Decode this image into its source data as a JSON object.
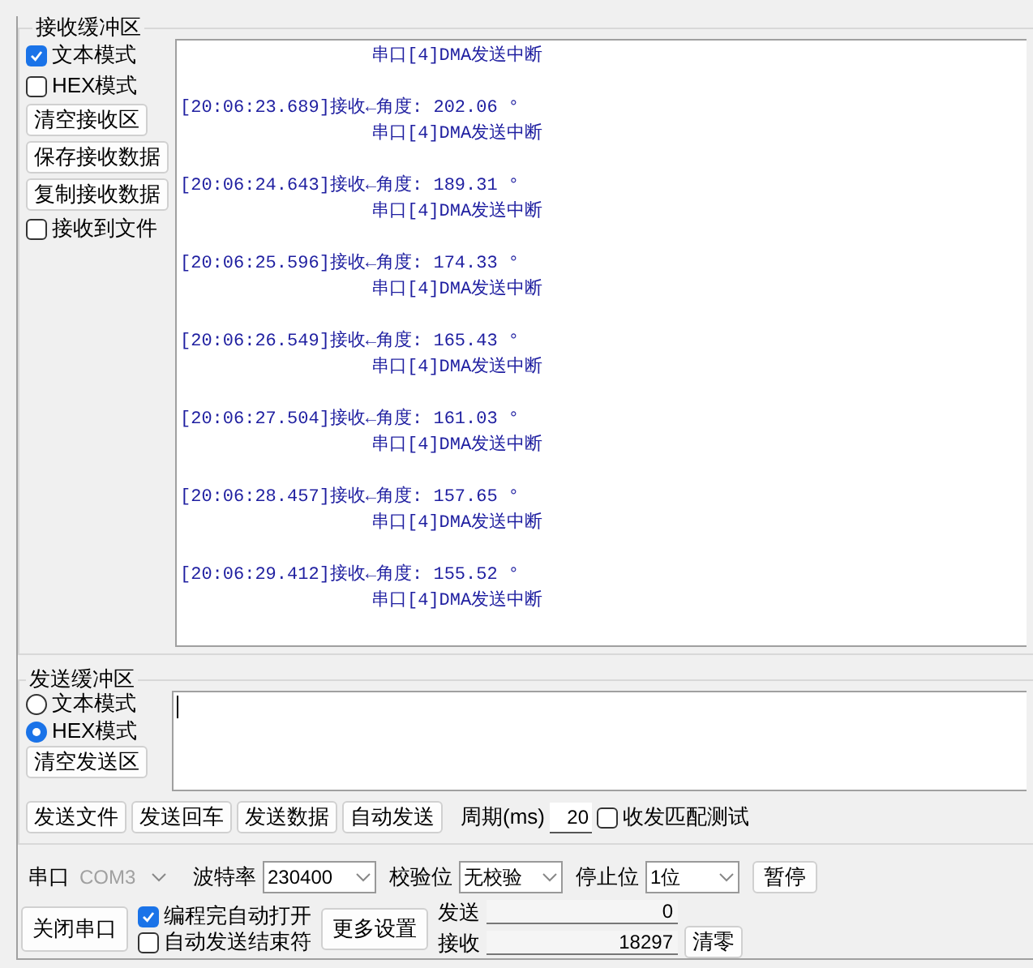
{
  "receive": {
    "title": "接收缓冲区",
    "controls": [
      {
        "kind": "checkbox",
        "label": "文本模式",
        "checked": true
      },
      {
        "kind": "checkbox",
        "label": "HEX模式",
        "checked": false
      },
      {
        "kind": "button",
        "label": "清空接收区"
      },
      {
        "kind": "button",
        "label": "保存接收数据"
      },
      {
        "kind": "button",
        "label": "复制接收数据"
      },
      {
        "kind": "checkbox",
        "label": "接收到文件",
        "checked": false
      }
    ],
    "log": [
      {
        "kind": "status",
        "text": "串口[4]DMA发送中断"
      },
      {
        "kind": "data",
        "text": "[20:06:23.689]接收←角度: 202.06 °"
      },
      {
        "kind": "status",
        "text": "串口[4]DMA发送中断"
      },
      {
        "kind": "data",
        "text": "[20:06:24.643]接收←角度: 189.31 °"
      },
      {
        "kind": "status",
        "text": "串口[4]DMA发送中断"
      },
      {
        "kind": "data",
        "text": "[20:06:25.596]接收←角度: 174.33 °"
      },
      {
        "kind": "status",
        "text": "串口[4]DMA发送中断"
      },
      {
        "kind": "data",
        "text": "[20:06:26.549]接收←角度: 165.43 °"
      },
      {
        "kind": "status",
        "text": "串口[4]DMA发送中断"
      },
      {
        "kind": "data",
        "text": "[20:06:27.504]接收←角度: 161.03 °"
      },
      {
        "kind": "status",
        "text": "串口[4]DMA发送中断"
      },
      {
        "kind": "data",
        "text": "[20:06:28.457]接收←角度: 157.65 °"
      },
      {
        "kind": "status",
        "text": "串口[4]DMA发送中断"
      },
      {
        "kind": "data",
        "text": "[20:06:29.412]接收←角度: 155.52 °"
      },
      {
        "kind": "status",
        "text": "串口[4]DMA发送中断"
      }
    ]
  },
  "send": {
    "title": "发送缓冲区",
    "modes": [
      {
        "label": "文本模式",
        "selected": false
      },
      {
        "label": "HEX模式",
        "selected": true
      }
    ],
    "clear_button": "清空发送区",
    "actions": [
      "发送文件",
      "发送回车",
      "发送数据",
      "自动发送"
    ],
    "period_label": "周期(ms)",
    "period_value": "20",
    "match_test": {
      "label": "收发匹配测试",
      "checked": false
    }
  },
  "serial": {
    "port_label": "串口",
    "port_value": "COM3",
    "port_disabled": true,
    "baud_label": "波特率",
    "baud_value": "230400",
    "parity_label": "校验位",
    "parity_value": "无校验",
    "stop_label": "停止位",
    "stop_value": "1位",
    "pause_button": "暂停"
  },
  "bottom": {
    "close_button": "关闭串口",
    "options": [
      {
        "label": "编程完自动打开",
        "checked": true
      },
      {
        "label": "自动发送结束符",
        "checked": false
      }
    ],
    "more_button": "更多设置",
    "counters": [
      {
        "label": "发送",
        "value": "0"
      },
      {
        "label": "接收",
        "value": "18297"
      }
    ],
    "reset_button": "清零"
  }
}
